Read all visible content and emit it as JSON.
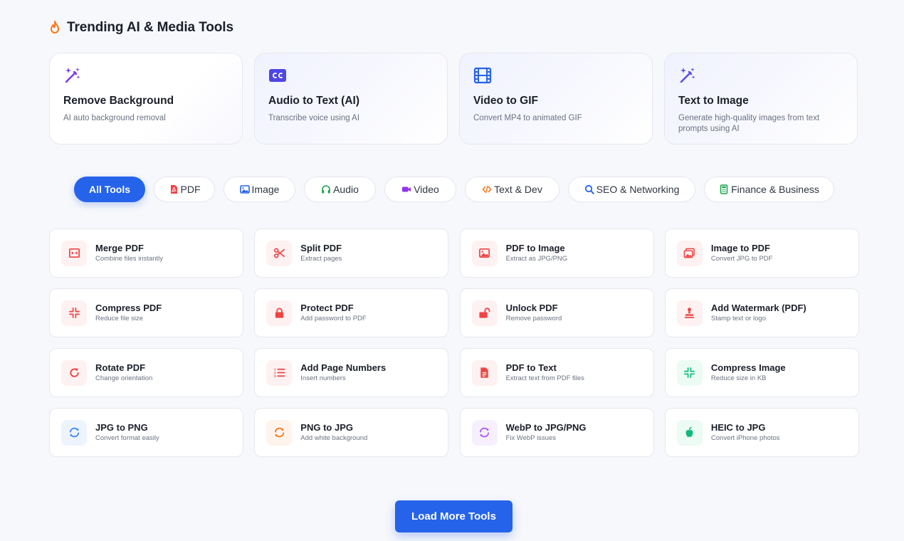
{
  "section": {
    "title": "Trending AI & Media Tools",
    "icon": "fire-icon"
  },
  "trending": [
    {
      "icon": "magic-wand-icon",
      "title": "Remove Background",
      "desc": "AI auto background removal"
    },
    {
      "icon": "closed-caption-icon",
      "title": "Audio to Text (AI)",
      "desc": "Transcribe voice using AI"
    },
    {
      "icon": "film-icon",
      "title": "Video to GIF",
      "desc": "Convert MP4 to animated GIF"
    },
    {
      "icon": "magic-wand-icon",
      "title": "Text to Image",
      "desc": "Generate high-quality images from text prompts using AI"
    }
  ],
  "filters": [
    {
      "label": "All Tools",
      "icon": "",
      "active": true
    },
    {
      "label": "PDF",
      "icon": "pdf-file-icon",
      "color": "#ef4444"
    },
    {
      "label": "Image",
      "icon": "image-icon",
      "color": "#2563eb"
    },
    {
      "label": "Audio",
      "icon": "headphones-icon",
      "color": "#16a34a"
    },
    {
      "label": "Video",
      "icon": "video-camera-icon",
      "color": "#9333ea"
    },
    {
      "label": "Text & Dev",
      "icon": "code-icon",
      "color": "#f97316"
    },
    {
      "label": "SEO & Networking",
      "icon": "search-icon",
      "color": "#2563eb"
    },
    {
      "label": "Finance & Business",
      "icon": "calculator-icon",
      "color": "#16a34a"
    }
  ],
  "tools": [
    {
      "title": "Merge PDF",
      "desc": "Combine files instantly",
      "icon": "merge-icon",
      "color": "#ef4444",
      "bg": "#fef1f1"
    },
    {
      "title": "Split PDF",
      "desc": "Extract pages",
      "icon": "scissors-icon",
      "color": "#ef4444",
      "bg": "#fef1f1"
    },
    {
      "title": "PDF to Image",
      "desc": "Extract as JPG/PNG",
      "icon": "image-icon",
      "color": "#ef4444",
      "bg": "#fef1f1"
    },
    {
      "title": "Image to PDF",
      "desc": "Convert JPG to PDF",
      "icon": "images-icon",
      "color": "#ef4444",
      "bg": "#fef1f1"
    },
    {
      "title": "Compress PDF",
      "desc": "Reduce file size",
      "icon": "compress-icon",
      "color": "#ef4444",
      "bg": "#fef1f1"
    },
    {
      "title": "Protect PDF",
      "desc": "Add password to PDF",
      "icon": "lock-icon",
      "color": "#ef4444",
      "bg": "#fef1f1"
    },
    {
      "title": "Unlock PDF",
      "desc": "Remove password",
      "icon": "unlock-icon",
      "color": "#ef4444",
      "bg": "#fef1f1"
    },
    {
      "title": "Add Watermark (PDF)",
      "desc": "Stamp text or logo",
      "icon": "stamp-icon",
      "color": "#ef4444",
      "bg": "#fef1f1"
    },
    {
      "title": "Rotate PDF",
      "desc": "Change orientation",
      "icon": "rotate-icon",
      "color": "#ef4444",
      "bg": "#fef1f1"
    },
    {
      "title": "Add Page Numbers",
      "desc": "Insert numbers",
      "icon": "numbered-list-icon",
      "color": "#ef4444",
      "bg": "#fef1f1"
    },
    {
      "title": "PDF to Text",
      "desc": "Extract text from PDF files",
      "icon": "file-text-icon",
      "color": "#ef4444",
      "bg": "#fef1f1"
    },
    {
      "title": "Compress Image",
      "desc": "Reduce size in KB",
      "icon": "compress-icon",
      "color": "#10b981",
      "bg": "#ecfbf4"
    },
    {
      "title": "JPG to PNG",
      "desc": "Convert format easily",
      "icon": "sync-icon",
      "color": "#3b82f6",
      "bg": "#eef4fe"
    },
    {
      "title": "PNG to JPG",
      "desc": "Add white background",
      "icon": "sync-icon",
      "color": "#f97316",
      "bg": "#fef4ec"
    },
    {
      "title": "WebP to JPG/PNG",
      "desc": "Fix WebP issues",
      "icon": "sync-icon",
      "color": "#a855f7",
      "bg": "#f6f0fe"
    },
    {
      "title": "HEIC to JPG",
      "desc": "Convert iPhone photos",
      "icon": "apple-icon",
      "color": "#10b981",
      "bg": "#ecfbf4"
    }
  ],
  "load_more": {
    "label": "Load More Tools"
  },
  "colors": {
    "accent": "#2563eb",
    "pdf_red": "#ef4444",
    "wand_purple": "#7c3aed"
  }
}
